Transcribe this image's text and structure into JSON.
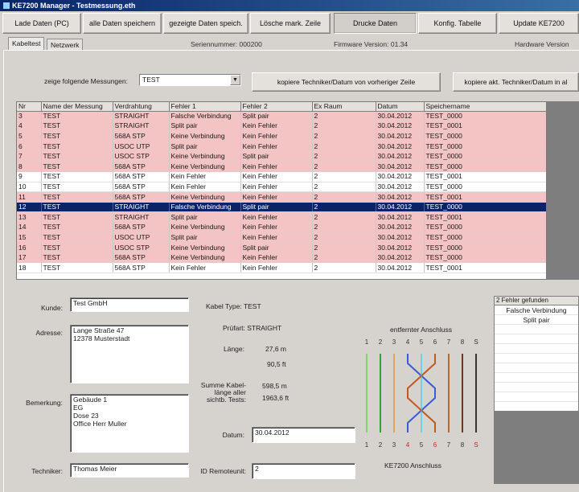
{
  "window": {
    "title": "KE7200 Manager - Testmessung.eth"
  },
  "toolbar": {
    "buttons": [
      "Lade Daten (PC)",
      "alle Daten speichern",
      "gezeigte Daten speich.",
      "Lösche mark. Zeile",
      "Drucke Daten",
      "Konfig. Tabelle",
      "Update KE7200"
    ]
  },
  "tabs": [
    "Kabeltest",
    "Netzwerk"
  ],
  "info": {
    "serial": "Seriennummer: 000200",
    "firmware": "Firmware Version: 01.34",
    "hardware": "Hardware Version"
  },
  "filter": {
    "label": "zeige folgende Messungen:",
    "value": "TEST",
    "copy_button": "kopiere Techniker/Datum von vorheriger Zeile",
    "copy_all_button": "kopiere akt. Techniker/Datum in al"
  },
  "table": {
    "columns": [
      "Nr",
      "Name der Messung",
      "Verdrahtung",
      "Fehler 1",
      "Fehler 2",
      "Ex Raum",
      "Datum",
      "Speichername"
    ],
    "rows": [
      {
        "state": "err",
        "cells": [
          "3",
          "TEST",
          "STRAIGHT",
          "Falsche Verbindung",
          "Split pair",
          "2",
          "30.04.2012",
          "TEST_0000"
        ]
      },
      {
        "state": "err",
        "cells": [
          "4",
          "TEST",
          "STRAIGHT",
          "Split pair",
          "Kein Fehler",
          "2",
          "30.04.2012",
          "TEST_0001"
        ]
      },
      {
        "state": "err",
        "cells": [
          "5",
          "TEST",
          "568A STP",
          "Keine Verbindung",
          "Kein Fehler",
          "2",
          "30.04.2012",
          "TEST_0000"
        ]
      },
      {
        "state": "err",
        "cells": [
          "6",
          "TEST",
          "USOC UTP",
          "Split pair",
          "Kein Fehler",
          "2",
          "30.04.2012",
          "TEST_0000"
        ]
      },
      {
        "state": "err",
        "cells": [
          "7",
          "TEST",
          "USOC STP",
          "Keine Verbindung",
          "Split pair",
          "2",
          "30.04.2012",
          "TEST_0000"
        ]
      },
      {
        "state": "err",
        "cells": [
          "8",
          "TEST",
          "568A STP",
          "Keine Verbindung",
          "Kein Fehler",
          "2",
          "30.04.2012",
          "TEST_0000"
        ]
      },
      {
        "state": "ok",
        "cells": [
          "9",
          "TEST",
          "568A STP",
          "Kein Fehler",
          "Kein Fehler",
          "2",
          "30.04.2012",
          "TEST_0001"
        ]
      },
      {
        "state": "ok",
        "cells": [
          "10",
          "TEST",
          "568A STP",
          "Kein Fehler",
          "Kein Fehler",
          "2",
          "30.04.2012",
          "TEST_0000"
        ]
      },
      {
        "state": "err",
        "cells": [
          "11",
          "TEST",
          "568A STP",
          "Keine Verbindung",
          "Kein Fehler",
          "2",
          "30.04.2012",
          "TEST_0001"
        ]
      },
      {
        "state": "sel",
        "cells": [
          "12",
          "TEST",
          "STRAIGHT",
          "Falsche Verbindung",
          "Split pair",
          "2",
          "30.04.2012",
          "TEST_0000"
        ]
      },
      {
        "state": "err",
        "cells": [
          "13",
          "TEST",
          "STRAIGHT",
          "Split pair",
          "Kein Fehler",
          "2",
          "30.04.2012",
          "TEST_0001"
        ]
      },
      {
        "state": "err",
        "cells": [
          "14",
          "TEST",
          "568A STP",
          "Keine Verbindung",
          "Kein Fehler",
          "2",
          "30.04.2012",
          "TEST_0000"
        ]
      },
      {
        "state": "err",
        "cells": [
          "15",
          "TEST",
          "USOC UTP",
          "Split pair",
          "Kein Fehler",
          "2",
          "30.04.2012",
          "TEST_0000"
        ]
      },
      {
        "state": "err",
        "cells": [
          "16",
          "TEST",
          "USOC STP",
          "Keine Verbindung",
          "Split pair",
          "2",
          "30.04.2012",
          "TEST_0000"
        ]
      },
      {
        "state": "err",
        "cells": [
          "17",
          "TEST",
          "568A STP",
          "Keine Verbindung",
          "Kein Fehler",
          "2",
          "30.04.2012",
          "TEST_0000"
        ]
      },
      {
        "state": "ok",
        "cells": [
          "18",
          "TEST",
          "568A STP",
          "Kein Fehler",
          "Kein Fehler",
          "2",
          "30.04.2012",
          "TEST_0001"
        ]
      }
    ]
  },
  "form": {
    "kunde_label": "Kunde:",
    "kunde_value": "Test GmbH",
    "adresse_label": "Adresse:",
    "adresse_lines": [
      "Lange Straße 47",
      "12378 Musterstadt"
    ],
    "bemerkung_label": "Bemerkung:",
    "bemerkung_lines": [
      "Gebäude 1",
      "EG",
      "Dose 23",
      "Office Herr Muller"
    ],
    "techniker_label": "Techniker:",
    "techniker_value": "Thomas Meier",
    "kabeltyp": "Kabel Type:  TEST",
    "pruefart": "Prüfart:  STRAIGHT",
    "laenge_label": "Länge:",
    "laenge_m": "27,6 m",
    "laenge_ft": "90,5 ft",
    "summe_label_1": "Summe Kabel-",
    "summe_label_2": "länge aller",
    "summe_label_3": "sichtb. Tests:",
    "summe_m": "598,5 m",
    "summe_ft": "1963,6 ft",
    "datum_label": "Datum:",
    "datum_value": "30.04.2012",
    "id_label": "ID Remoteunit:",
    "id_value": "2"
  },
  "wiremap": {
    "top_label": "entfernter Anschluss",
    "bottom_label": "KE7200 Anschluss",
    "top_pins": [
      "1",
      "2",
      "3",
      "4",
      "5",
      "6",
      "7",
      "8",
      "S"
    ],
    "bottom_pins": [
      "1",
      "2",
      "3",
      "4",
      "5",
      "6",
      "7",
      "8",
      "S"
    ],
    "colors": [
      "#7fd36b",
      "#2fa52f",
      "#e8a35a",
      "#3b5bd6",
      "#6fd0e6",
      "#c05a1f",
      "#b06a3a",
      "#6b3a1a",
      "#333333"
    ]
  },
  "errors": {
    "header": "2 Fehler gefunden",
    "items": [
      "Falsche Verbindung",
      "Split pair"
    ]
  }
}
